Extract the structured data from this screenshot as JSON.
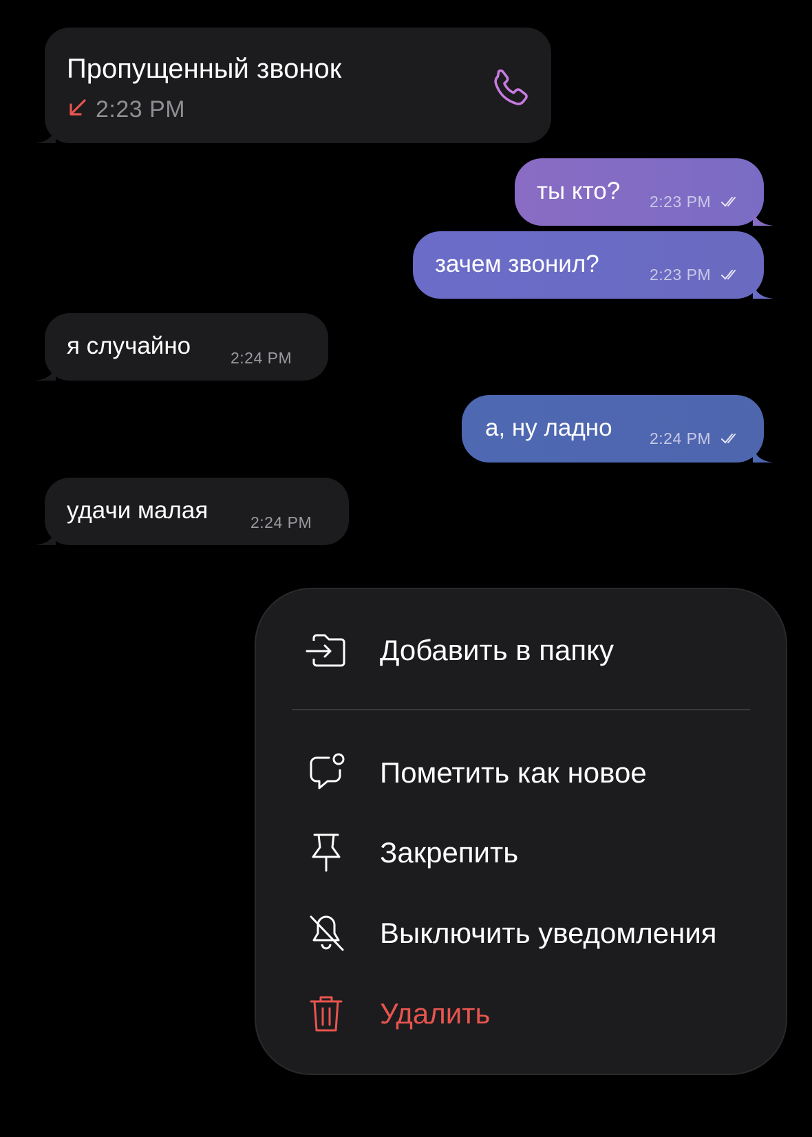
{
  "colors": {
    "background": "#000000",
    "incoming_bubble": "#1c1c1e",
    "outgoing_gradient_top": "#8a6cc4",
    "outgoing_gradient_bottom": "#4a66b0",
    "missed_call_arrow": "#e8554e",
    "call_icon": "#c77be0",
    "danger": "#e8554e"
  },
  "messages": {
    "missed_call": {
      "title": "Пропущенный звонок",
      "time": "2:23 PM",
      "arrow_icon": "missed-call-arrow-icon",
      "call_icon": "phone-icon"
    },
    "m1": {
      "text": "ты кто?",
      "time": "2:23 PM",
      "status": "read"
    },
    "m2": {
      "text": "зачем звонил?",
      "time": "2:23 PM",
      "status": "read"
    },
    "m3": {
      "text": "я случайно",
      "time": "2:24 PM"
    },
    "m4": {
      "text": "а, ну ладно",
      "time": "2:24 PM",
      "status": "read"
    },
    "m5": {
      "text": "удачи малая",
      "time": "2:24 PM"
    }
  },
  "context_menu": {
    "add_to_folder": {
      "label": "Добавить в папку",
      "icon": "folder-add-icon"
    },
    "mark_as_new": {
      "label": "Пометить как новое",
      "icon": "chat-badge-icon"
    },
    "pin": {
      "label": "Закрепить",
      "icon": "pin-icon"
    },
    "mute": {
      "label": "Выключить уведомления",
      "icon": "bell-off-icon"
    },
    "delete": {
      "label": "Удалить",
      "icon": "trash-icon"
    }
  }
}
